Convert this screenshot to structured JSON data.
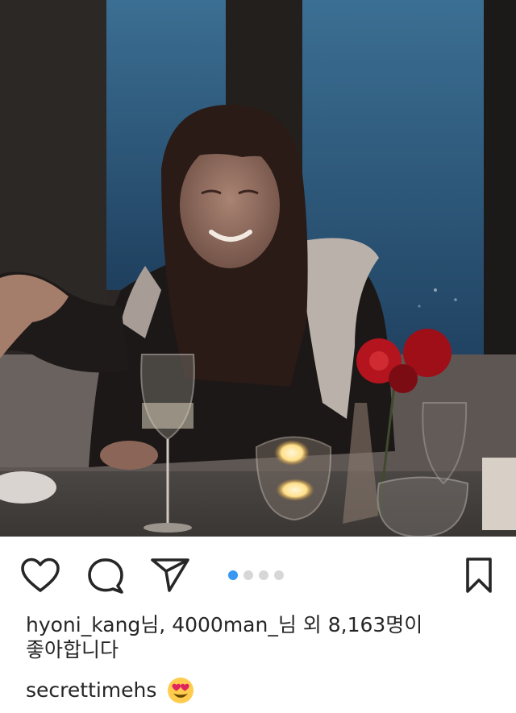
{
  "post": {
    "image_alt": "Woman with long dark hair smiling at a restaurant table with wine glasses, candles and red roses, night city window behind",
    "carousel": {
      "total": 4,
      "active": 1
    },
    "likes_line1": "hyoni_kang님, 4000man_님 외 8,163명이",
    "likes_line2": "좋아합니다",
    "caption_user": "secrettimehs",
    "caption_emoji": "heart-eyes-emoji"
  },
  "icons": {
    "like": "heart-icon",
    "comment": "comment-bubble-icon",
    "share": "paper-plane-icon",
    "save": "bookmark-icon"
  },
  "colors": {
    "text": "#262626",
    "carousel_active": "#3897f0",
    "carousel_inactive": "#d7d7d7"
  }
}
